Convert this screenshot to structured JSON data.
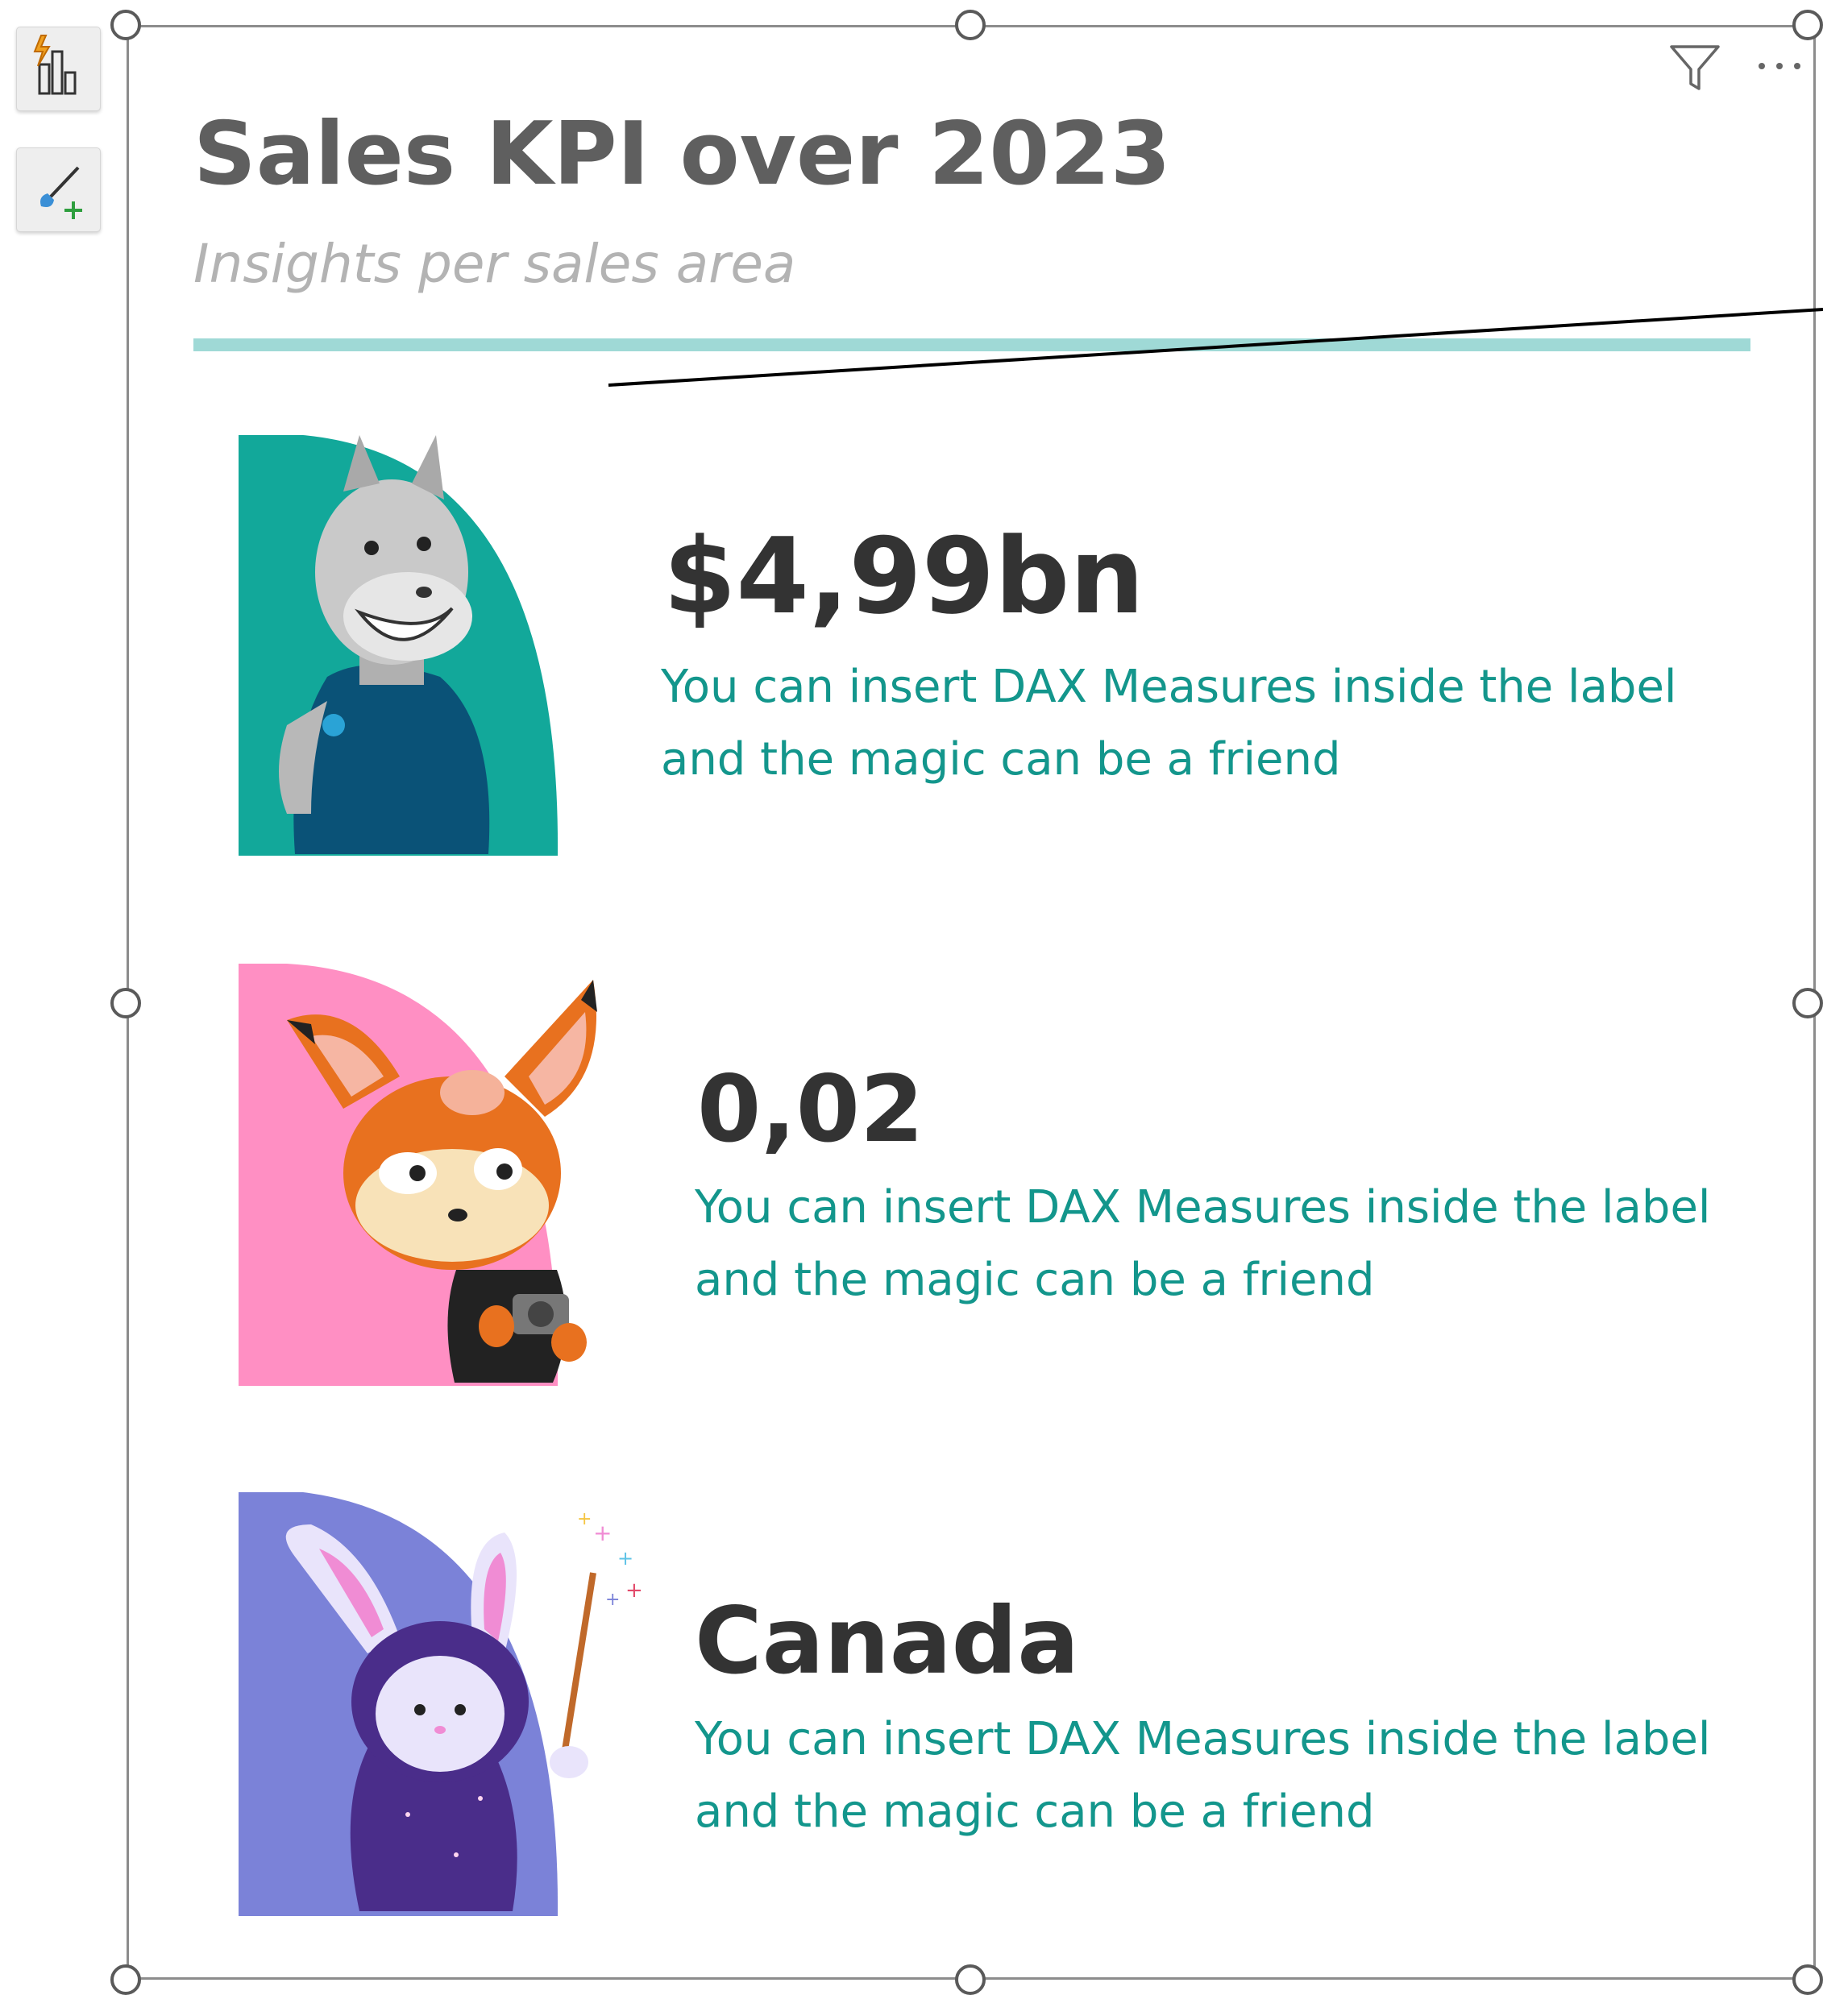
{
  "toolbar": {
    "buttons": [
      {
        "icon": "smart-narrative-icon"
      },
      {
        "icon": "format-visual-icon"
      }
    ]
  },
  "visual": {
    "header_icons": [
      "filter-icon",
      "more-options-icon"
    ],
    "title": "Sales KPI over 2023",
    "subtitle": "Insights per sales area",
    "accent_color": "#9fd9d6"
  },
  "cards": [
    {
      "character": "donkey-mascot",
      "background_color": "#12a89a",
      "value": "$4,99bn",
      "description": "You can insert DAX Measures inside the label and the magic can be a friend"
    },
    {
      "character": "fox-mascot",
      "background_color": "#ff8fc3",
      "value": "0,02",
      "description": "You can insert DAX Measures inside the label and the magic can be a friend"
    },
    {
      "character": "bunny-wizard-mascot",
      "background_color": "#7b82d8",
      "value": "Canada",
      "description": "You can insert DAX Measures inside the label and the magic can be a friend"
    }
  ],
  "colors": {
    "value_text": "#333333",
    "description_text": "#13968c",
    "title_text": "#5f5f5f",
    "subtitle_text": "#b3b3b3"
  }
}
